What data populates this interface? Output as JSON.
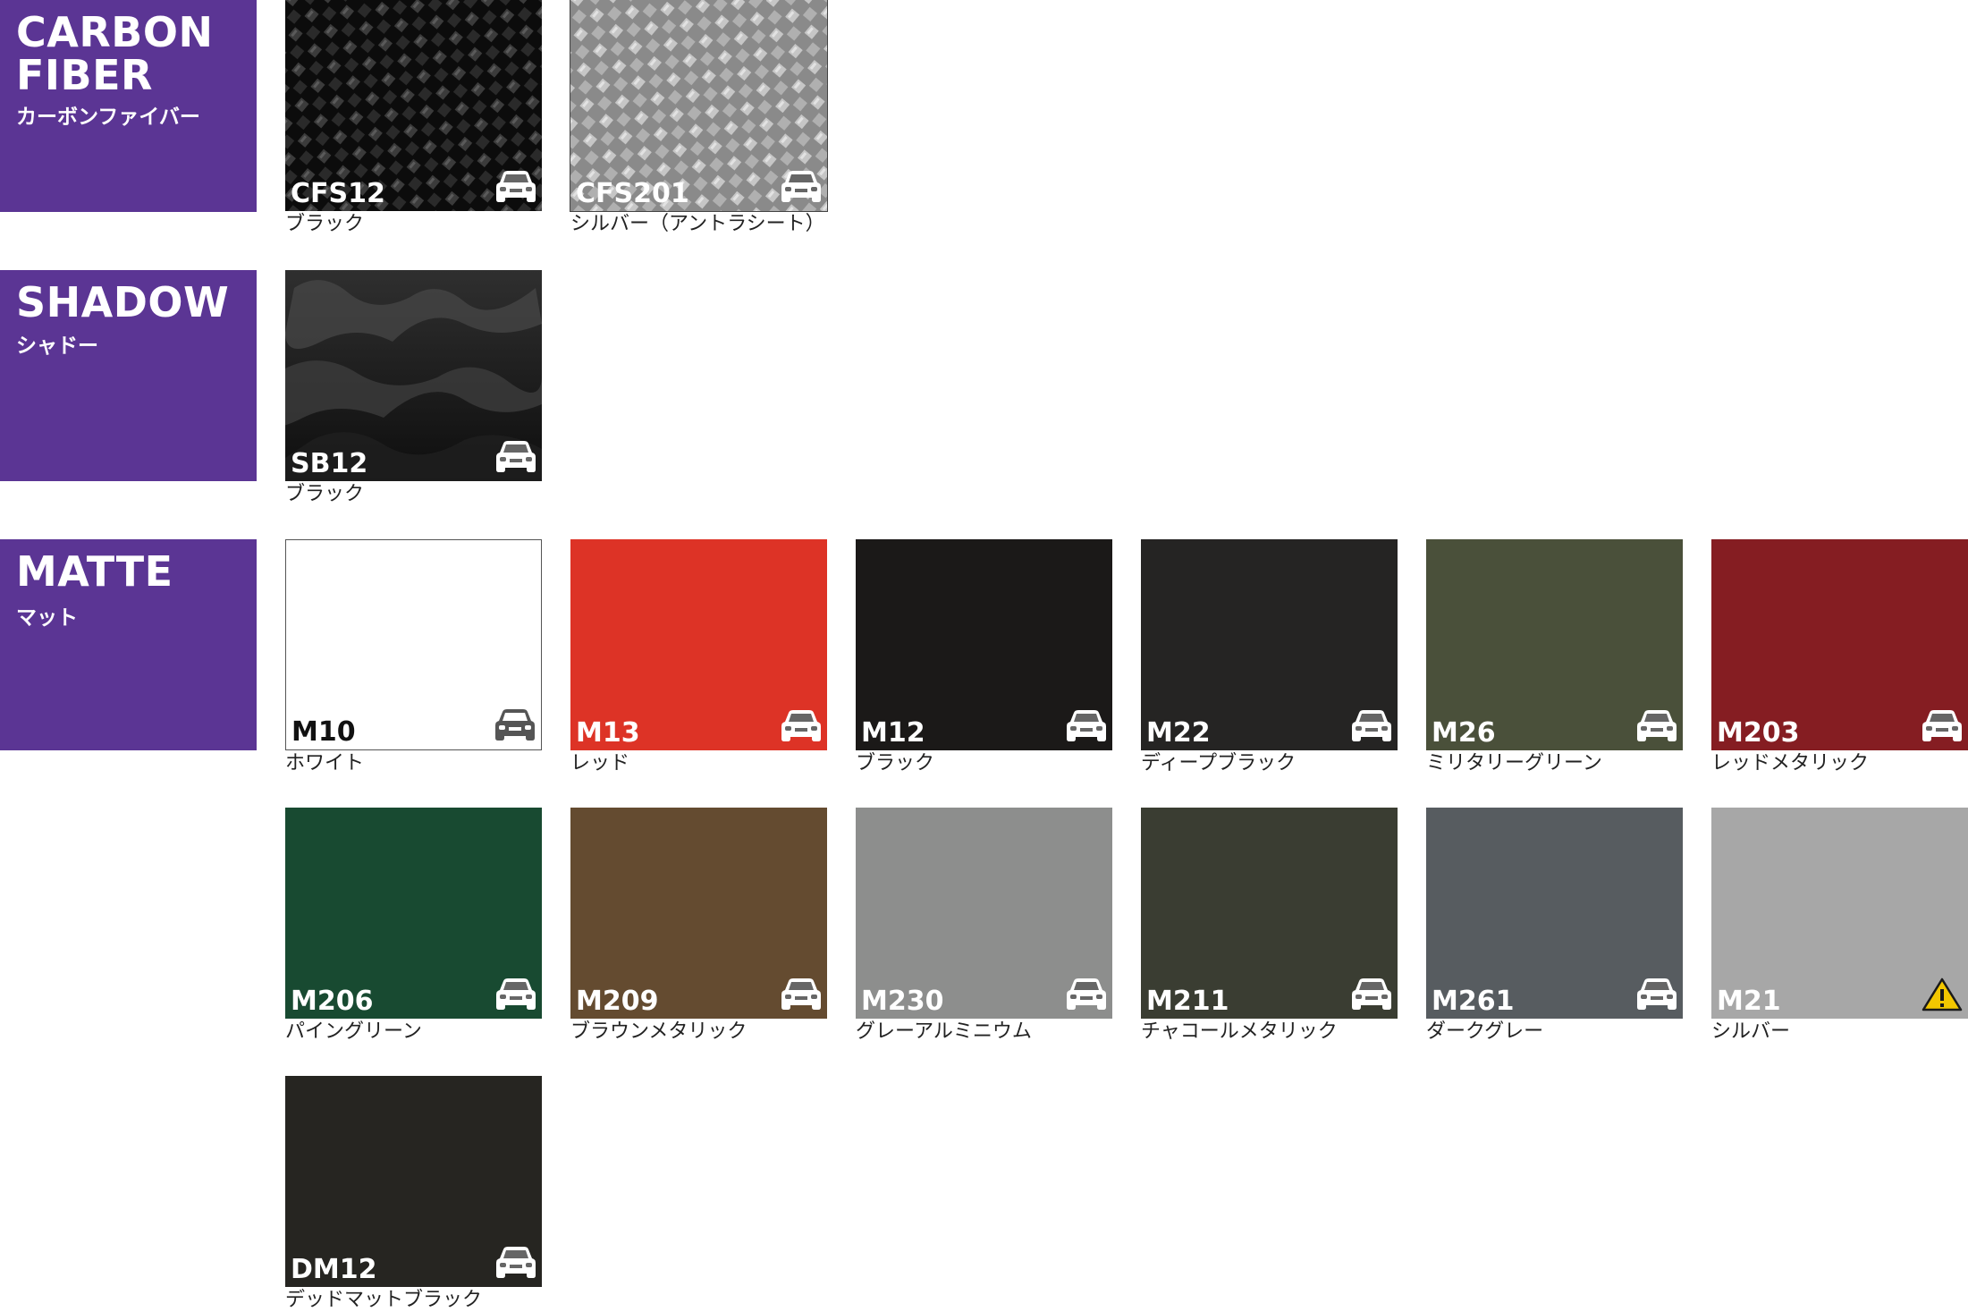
{
  "categories": {
    "carbon": {
      "en": "CARBON\nFIBER",
      "jp": "カーボンファイバー"
    },
    "shadow": {
      "en": "SHADOW",
      "jp": "シャドー"
    },
    "matte": {
      "en": "MATTE",
      "jp": "マット"
    }
  },
  "swatches": [
    {
      "code": "CFS12",
      "name": "ブラック",
      "color": "#1a1a1a",
      "pattern": "carbon-dark",
      "icon": "car-icon"
    },
    {
      "code": "CFS201",
      "name": "シルバー（アントラシート）",
      "color": "#9a9a9a",
      "pattern": "carbon-silver",
      "icon": "car-icon"
    },
    {
      "code": "SB12",
      "name": "ブラック",
      "color": "#2a2a2a",
      "pattern": "camo",
      "icon": "car-icon"
    },
    {
      "code": "M10",
      "name": "ホワイト",
      "color": "#ffffff",
      "icon": "car-icon"
    },
    {
      "code": "M13",
      "name": "レッド",
      "color": "#dd3326",
      "icon": "car-icon"
    },
    {
      "code": "M12",
      "name": "ブラック",
      "color": "#1b1918",
      "icon": "car-icon"
    },
    {
      "code": "M22",
      "name": "ディープブラック",
      "color": "#252423",
      "icon": "car-icon"
    },
    {
      "code": "M26",
      "name": "ミリタリーグリーン",
      "color": "#4a503a",
      "icon": "car-icon"
    },
    {
      "code": "M203",
      "name": "レッドメタリック",
      "color": "#851d22",
      "icon": "car-icon"
    },
    {
      "code": "M206",
      "name": "パイングリーン",
      "color": "#184a31",
      "icon": "car-icon"
    },
    {
      "code": "M209",
      "name": "ブラウンメタリック",
      "color": "#644b30",
      "icon": "car-icon"
    },
    {
      "code": "M230",
      "name": "グレーアルミニウム",
      "color": "#8d8e8d",
      "icon": "car-icon"
    },
    {
      "code": "M211",
      "name": "チャコールメタリック",
      "color": "#3a3d32",
      "icon": "car-icon"
    },
    {
      "code": "M261",
      "name": "ダークグレー",
      "color": "#575c60",
      "icon": "car-icon"
    },
    {
      "code": "M21",
      "name": "シルバー",
      "color": "#a7a7a7",
      "icon": "warning-icon"
    },
    {
      "code": "DM12",
      "name": "デッドマットブラック",
      "color": "#262521",
      "icon": "car-icon"
    }
  ]
}
